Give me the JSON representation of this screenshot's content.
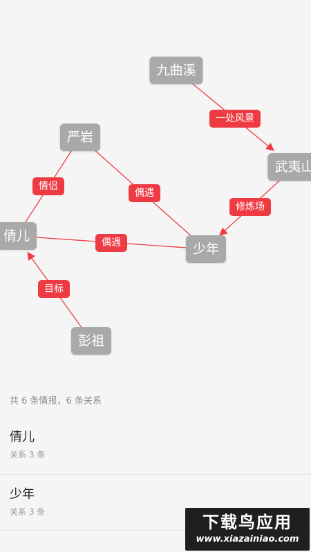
{
  "graph": {
    "nodes": [
      {
        "id": "jiuquxi",
        "label": "九曲溪"
      },
      {
        "id": "yanyan",
        "label": "严岩"
      },
      {
        "id": "wuyishan",
        "label": "武夷山"
      },
      {
        "id": "qianer",
        "label": "倩儿"
      },
      {
        "id": "shaonian",
        "label": "少年"
      },
      {
        "id": "pengzu",
        "label": "彭祖"
      }
    ],
    "edges": [
      {
        "from": "jiuquxi",
        "to": "wuyishan",
        "label": "一处风景"
      },
      {
        "from": "yanyan",
        "to": "qianer",
        "label": "情侣"
      },
      {
        "from": "yanyan",
        "to": "shaonian",
        "label": "偶遇"
      },
      {
        "from": "wuyishan",
        "to": "shaonian",
        "label": "修炼场"
      },
      {
        "from": "qianer",
        "to": "shaonian",
        "label": "偶遇"
      },
      {
        "from": "pengzu",
        "to": "qianer",
        "label": "目标"
      }
    ],
    "node_color": "#a9a9a9",
    "edge_color": "#ee3b43"
  },
  "summary": "共 6 条情报，6 条关系",
  "list": [
    {
      "name": "倩儿",
      "sub": "关系 3 条"
    },
    {
      "name": "少年",
      "sub": "关系 3 条"
    }
  ],
  "watermark": {
    "title": "下载鸟应用",
    "url": "www.xiazainiao.com"
  }
}
